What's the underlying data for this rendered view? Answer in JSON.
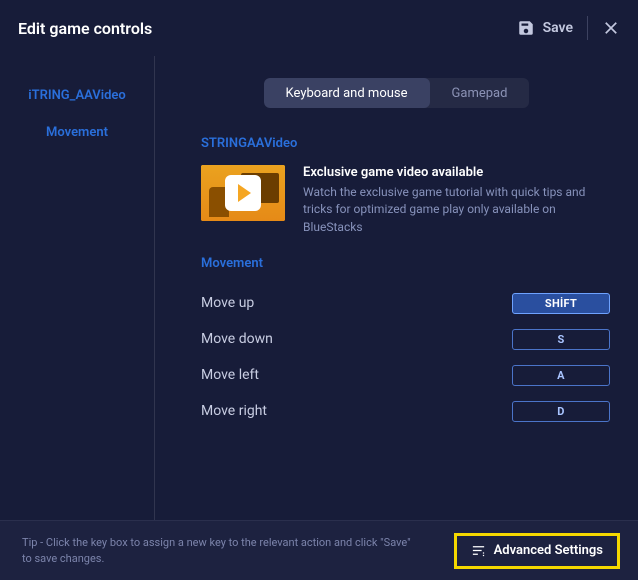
{
  "header": {
    "title": "Edit game controls",
    "save_label": "Save"
  },
  "sidebar": {
    "items": [
      {
        "label": "iTRING_AAVideo"
      },
      {
        "label": "Movement"
      }
    ]
  },
  "tabs": {
    "items": [
      {
        "label": "Keyboard and mouse",
        "active": true
      },
      {
        "label": "Gamepad",
        "active": false
      }
    ]
  },
  "video_section": {
    "label": "STRINGAAVideo",
    "title": "Exclusive game video available",
    "description": "Watch the exclusive game tutorial with quick tips and tricks for optimized game play only available on BlueStacks"
  },
  "movement_section": {
    "label": "Movement",
    "bindings": [
      {
        "action": "Move up",
        "key": "SHİFT",
        "active": true
      },
      {
        "action": "Move down",
        "key": "S",
        "active": false
      },
      {
        "action": "Move left",
        "key": "A",
        "active": false
      },
      {
        "action": "Move right",
        "key": "D",
        "active": false
      }
    ]
  },
  "footer": {
    "tip": "Tip - Click the key box to assign a new key to the relevant action and click \"Save\" to save changes.",
    "advanced_label": "Advanced Settings"
  }
}
